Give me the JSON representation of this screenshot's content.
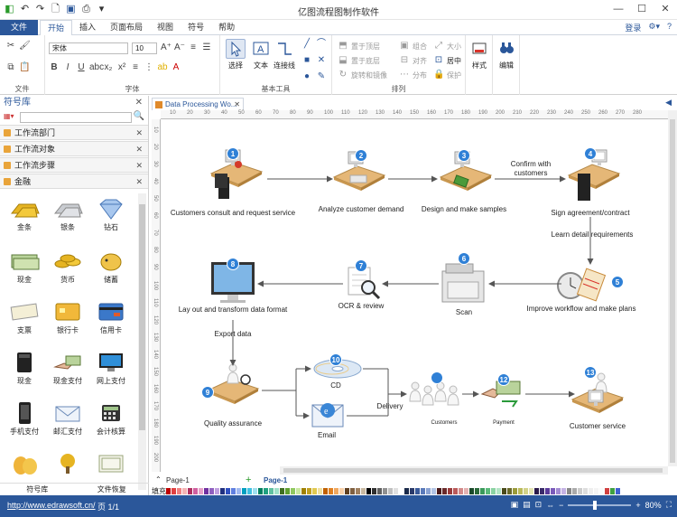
{
  "window": {
    "title": "亿图流程图制作软件"
  },
  "menu": {
    "file": "文件",
    "tabs": [
      "开始",
      "插入",
      "页面布局",
      "视图",
      "符号",
      "帮助"
    ],
    "login": "登录"
  },
  "ribbon": {
    "groups": {
      "file": "文件",
      "font": "字体",
      "basic_tools": "基本工具",
      "arrange": "排列"
    },
    "font_name": "宋体",
    "font_size": "10",
    "tools": {
      "select": "选择",
      "text": "文本",
      "connector": "连接线"
    },
    "arrange": {
      "bring_front": "置于顶层",
      "send_back": "置于底层",
      "rotate_mirror": "旋转和镜像",
      "group": "组合",
      "align": "对齐",
      "distribute": "分布",
      "size": "大小",
      "center": "居中",
      "protect": "保护"
    },
    "style": "样式",
    "edit": "编辑"
  },
  "library": {
    "title": "符号库",
    "categories": [
      "工作流部门",
      "工作流对象",
      "工作流步骤",
      "金融"
    ],
    "shapes": [
      "金条",
      "银条",
      "钻石",
      "现金",
      "货币",
      "储蓄",
      "支票",
      "银行卡",
      "信用卡",
      "现金",
      "现金支付",
      "网上支付",
      "手机支付",
      "邮汇支付",
      "会计核算"
    ],
    "footer": [
      "符号库",
      "文件恢复"
    ]
  },
  "document": {
    "tab": "Data Processing Wo..."
  },
  "ruler": {
    "h": [
      "10",
      "20",
      "30",
      "40",
      "50",
      "60",
      "70",
      "80",
      "90",
      "100",
      "110",
      "120",
      "130",
      "140",
      "150",
      "160",
      "170",
      "180",
      "190",
      "200",
      "210",
      "220",
      "230",
      "240",
      "250",
      "260",
      "270",
      "280"
    ],
    "v": [
      "10",
      "20",
      "30",
      "40",
      "50",
      "60",
      "70",
      "80",
      "90",
      "100",
      "110",
      "120",
      "130",
      "140",
      "150",
      "160",
      "170",
      "180",
      "190",
      "200"
    ]
  },
  "diagram": {
    "steps": [
      {
        "num": "1",
        "label": "Customers consult and request service"
      },
      {
        "num": "2",
        "label": "Analyze customer demand"
      },
      {
        "num": "3",
        "label": "Design and make samples"
      },
      {
        "num": "4",
        "label": "Sign agreement/contract"
      },
      {
        "num": "5",
        "label": "Improve workflow and make plans"
      },
      {
        "num": "6",
        "label": "Scan"
      },
      {
        "num": "7",
        "label": "OCR & review"
      },
      {
        "num": "8",
        "label": "Lay out and transform data  format"
      },
      {
        "num": "9",
        "label": "Quality assurance"
      },
      {
        "num": "10",
        "label": "CD"
      },
      {
        "num": "",
        "label": "Email"
      },
      {
        "num": "11",
        "label": "Customers"
      },
      {
        "num": "12",
        "label": "Payment"
      },
      {
        "num": "13",
        "label": "Customer service"
      }
    ],
    "edge_labels": {
      "confirm": "Confirm with",
      "confirm2": "customers",
      "learn": "Learn detail requirements",
      "export": "Export data",
      "delivery": "Delivery"
    }
  },
  "pages": {
    "page1": "Page-1",
    "active": "Page-1"
  },
  "palette": {
    "label": "填充"
  },
  "status": {
    "url": "http://www.edrawsoft.cn/",
    "page": "页 1/1",
    "zoom": "80%"
  }
}
